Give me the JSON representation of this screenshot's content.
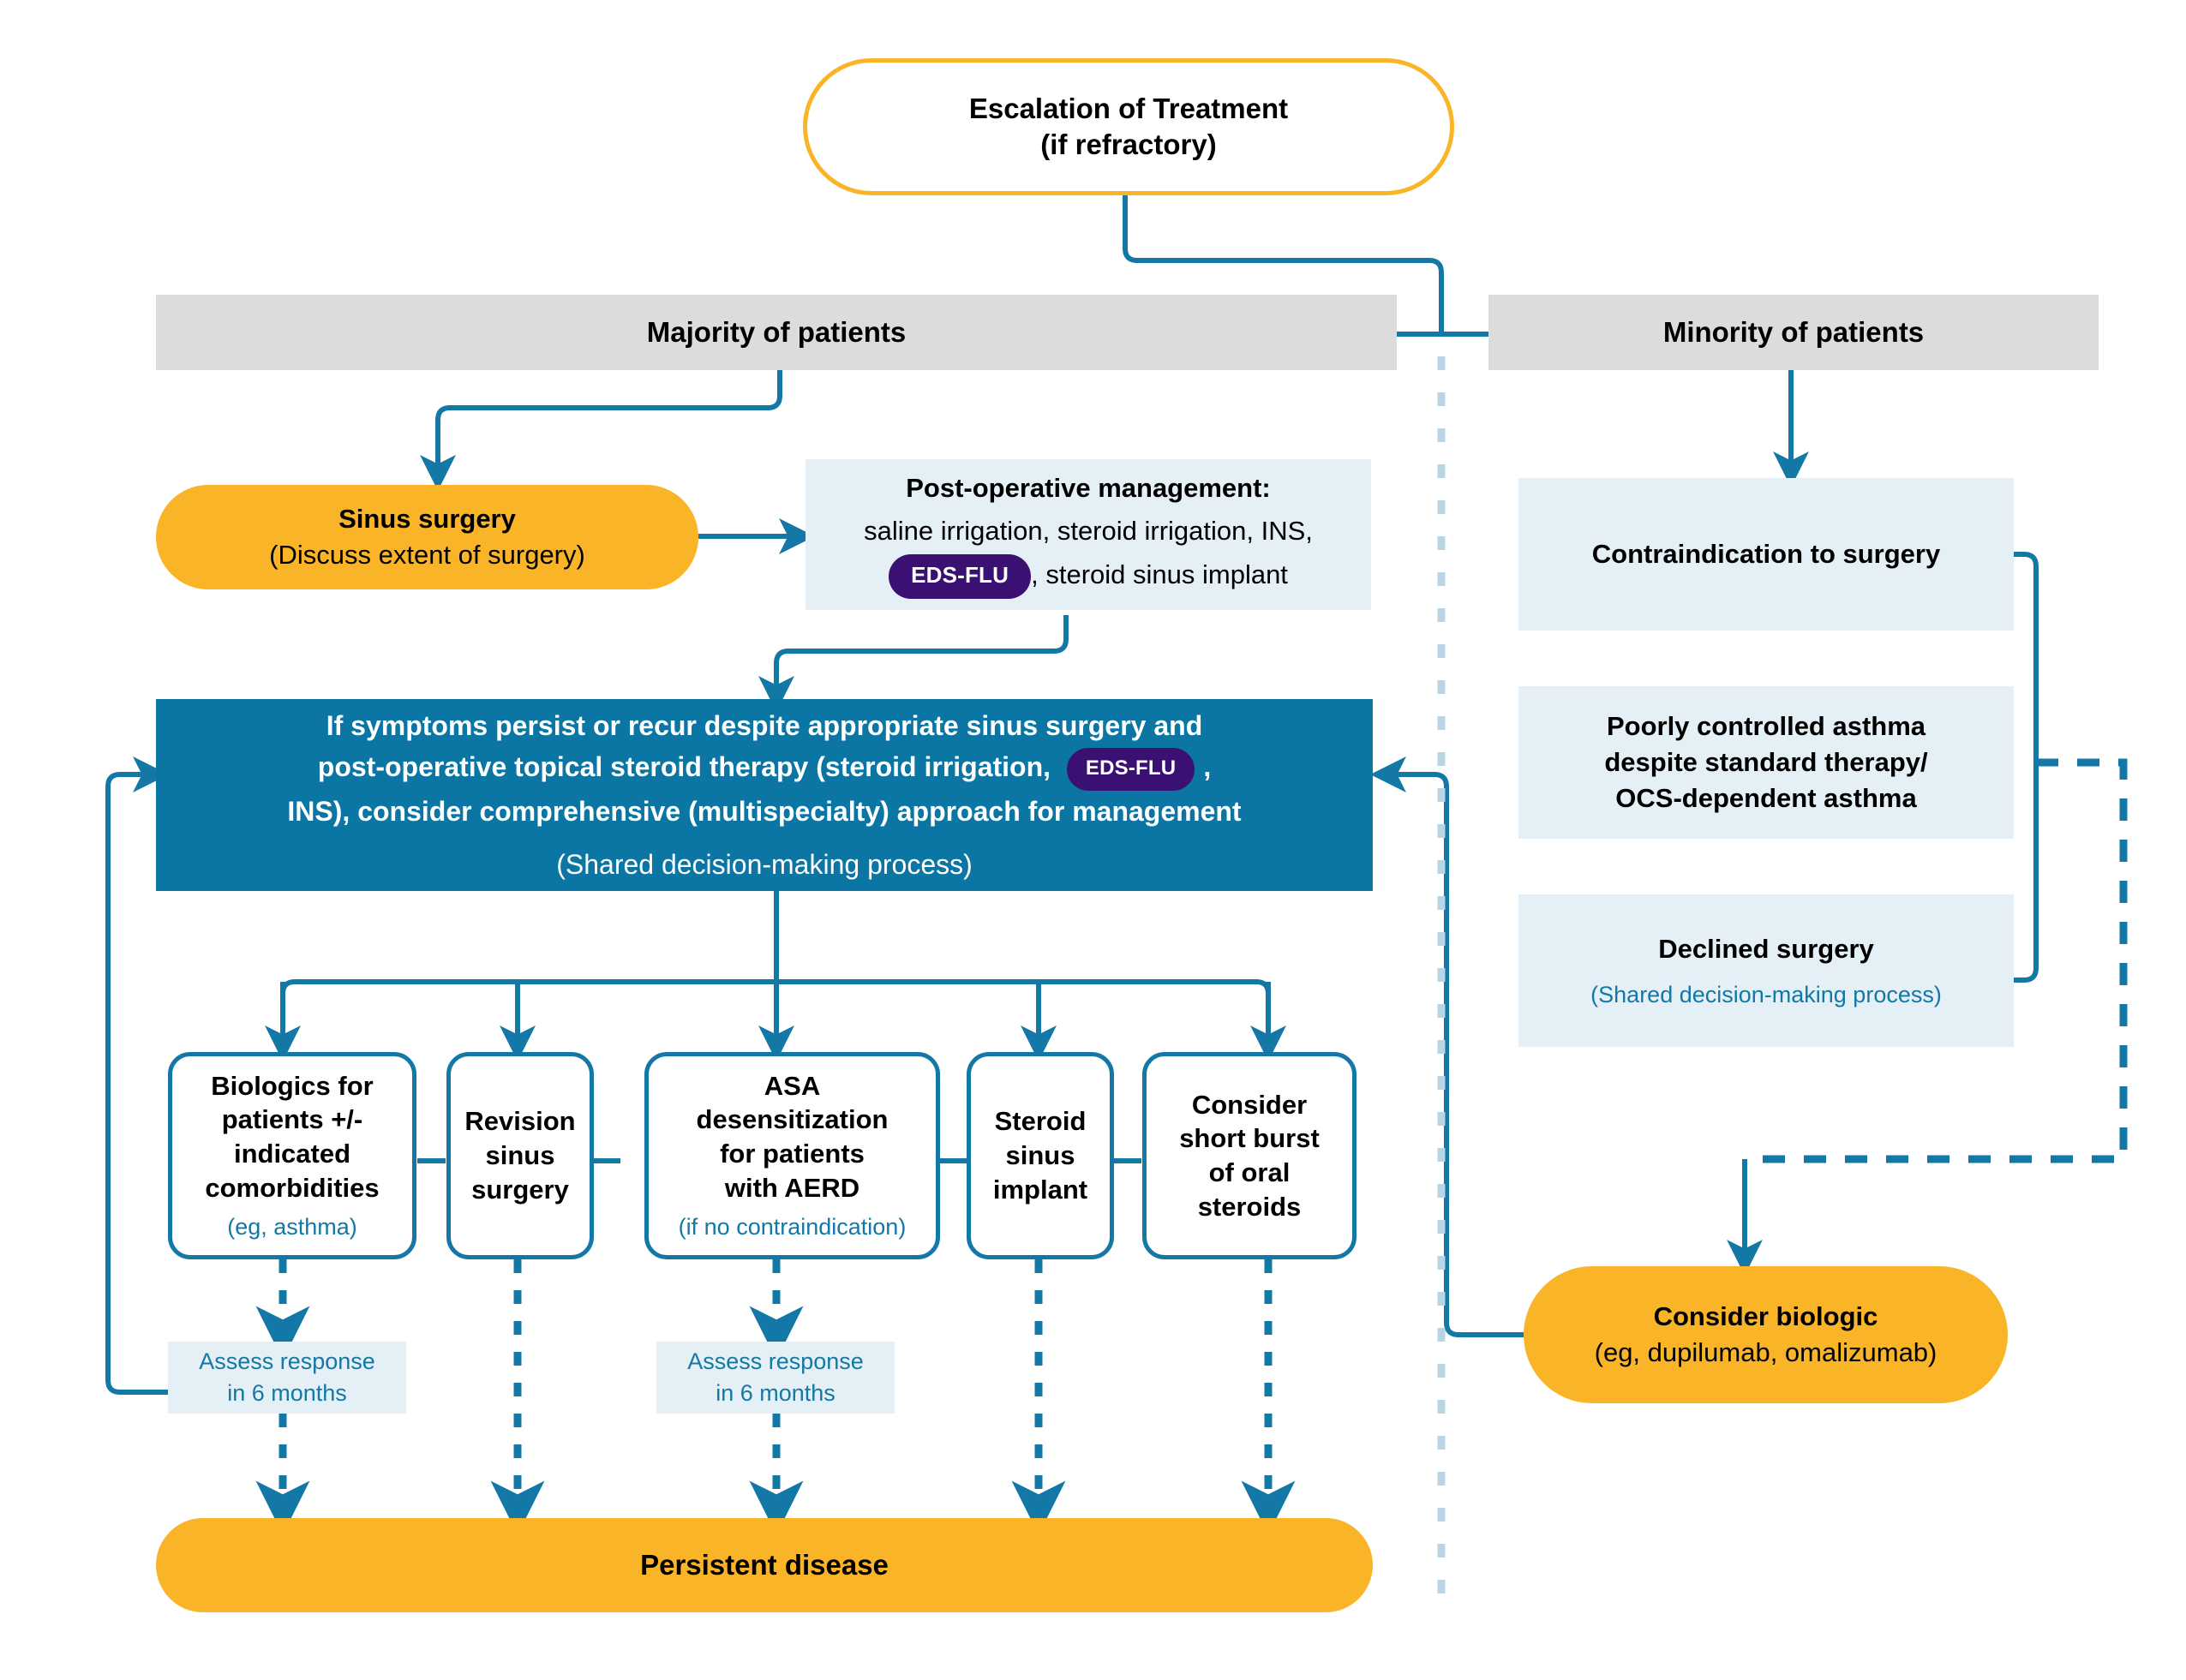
{
  "diagram": {
    "title_node": {
      "line1": "Escalation of Treatment",
      "line2": "(if refractory)"
    },
    "bands": {
      "majority": "Majority of patients",
      "minority": "Minority of patients"
    },
    "majority_branch": {
      "sinus_surgery": {
        "title": "Sinus surgery",
        "subtitle": "(Discuss extent of surgery)"
      },
      "post_op": {
        "title": "Post-operative management:",
        "line1": "saline irrigation, steroid irrigation, INS,",
        "badge": "EDS-FLU",
        "line2_tail": ", steroid sinus implant"
      },
      "persist_box": {
        "line1": "If symptoms persist or recur despite appropriate sinus surgery and",
        "line2_pre": "post-operative topical steroid therapy (steroid irrigation,",
        "badge": "EDS-FLU",
        "line2_post": ",",
        "line3": "INS), consider comprehensive (multispecialty) approach for management",
        "subtitle": "(Shared decision-making process)"
      },
      "options": [
        {
          "lines": [
            "Biologics for",
            "patients +/-",
            "indicated",
            "comorbidities"
          ],
          "subtitle": "(eg, asthma)"
        },
        {
          "lines": [
            "Revision",
            "sinus",
            "surgery"
          ],
          "subtitle": ""
        },
        {
          "lines": [
            "ASA",
            "desensitization",
            "for patients",
            "with AERD"
          ],
          "subtitle": "(if no contraindication)"
        },
        {
          "lines": [
            "Steroid",
            "sinus",
            "implant"
          ],
          "subtitle": ""
        },
        {
          "lines": [
            "Consider",
            "short burst",
            "of oral",
            "steroids"
          ],
          "subtitle": ""
        }
      ],
      "assess": {
        "line1": "Assess response",
        "line2": "in 6 months"
      },
      "persistent_disease": "Persistent disease"
    },
    "minority_branch": {
      "reasons": [
        {
          "lines": [
            "Contraindication to surgery"
          ],
          "subtitle": ""
        },
        {
          "lines": [
            "Poorly controlled asthma",
            "despite standard therapy/",
            "OCS-dependent asthma"
          ],
          "subtitle": ""
        },
        {
          "lines": [
            "Declined surgery"
          ],
          "subtitle": "(Shared decision-making process)"
        }
      ],
      "consider_biologic": {
        "title": "Consider biologic",
        "subtitle": "(eg, dupilumab, omalizumab)"
      }
    },
    "colors": {
      "orange": "#F9B428",
      "dark_blue": "#0B75A3",
      "light_blue_box": "#E4EFF6",
      "grey_band": "#DCDCDC",
      "connector_blue": "#1378A5",
      "badge_purple": "#3A1173",
      "divider_blue": "#B7D5E4"
    }
  }
}
